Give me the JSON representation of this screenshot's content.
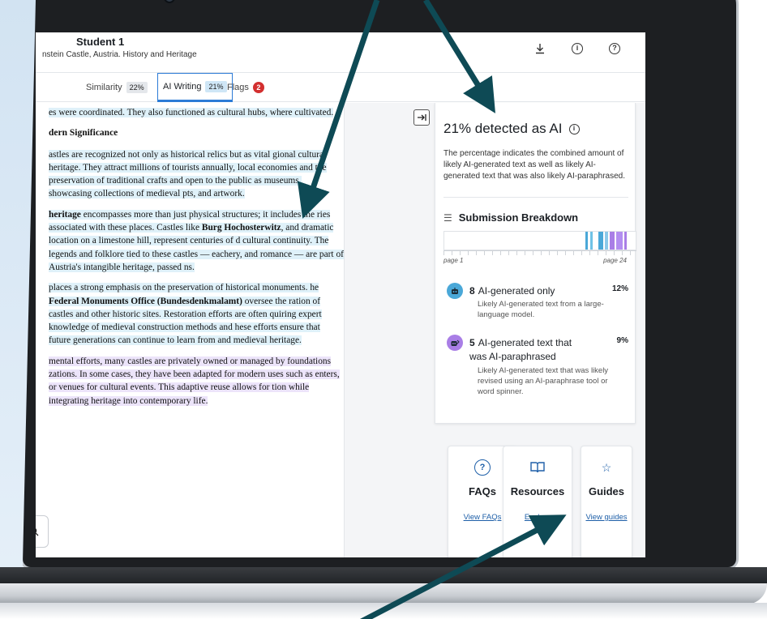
{
  "header": {
    "student_name": "Student 1",
    "doc_title": "nstein Castle, Austria. History and Heritage",
    "icons": [
      "download-icon",
      "info-icon",
      "help-icon"
    ]
  },
  "tabs": [
    {
      "label": "Similarity",
      "badge": "22%"
    },
    {
      "label": "AI Writing",
      "badge": "21%",
      "active": true
    },
    {
      "label": "Flags",
      "badge": "2"
    }
  ],
  "document": {
    "p1": "es were coordinated. They also functioned as cultural hubs, where cultivated.",
    "h1": "dern Significance",
    "p2": "astles are recognized not only as historical relics but as vital gional cultural heritage. They attract millions of tourists annually, local economies and the preservation of traditional crafts and open to the public as museums, showcasing collections of medieval pts, and artwork.",
    "p3a": "heritage",
    "p3b": " encompasses more than just physical structures; it includes the ries associated with these places. Castles like ",
    "p3c": "Burg Hochosterwitz",
    "p3d": ", and dramatic location on a limestone hill, represent centuries of d cultural continuity. The legends and folklore tied to these castles — eachery, and romance — are part of Austria's intangible heritage, passed ns.",
    "p4a": "places a strong emphasis on the preservation of historical monuments. he ",
    "p4b": "Federal Monuments Office (Bundesdenkmalamt)",
    "p4c": " oversee the ration of castles and other historic sites. Restoration efforts are often quiring expert knowledge of medieval construction methods and hese efforts ensure that future generations can continue to learn from and medieval heritage.",
    "p5": "mental efforts, many castles are privately owned or managed by foundations zations. In some cases, they have been adapted for modern uses such as enters, or venues for cultural events. This adaptive reuse allows for tion while integrating heritage into contemporary life."
  },
  "ai_panel": {
    "title": "21% detected as AI",
    "description": "The percentage indicates the combined amount of likely AI-generated text as well as likely AI-generated text that was also likely AI-paraphrased.",
    "breakdown_title": "Submission Breakdown",
    "page_first": "page 1",
    "page_last": "page 24",
    "categories": [
      {
        "count": "8",
        "label": "AI-generated only",
        "pct": "12%",
        "desc": "Likely AI-generated text from a large-language model.",
        "color": "#4aa8d8"
      },
      {
        "count": "5",
        "label": "AI-generated text that was AI-paraphrased",
        "pct": "9%",
        "desc": "Likely AI-generated text that was likely revised using an AI-paraphrase tool or word spinner.",
        "color": "#a97ee6"
      }
    ]
  },
  "resources": [
    {
      "title": "FAQs",
      "link": "View FAQs",
      "icon": "question-circle-icon"
    },
    {
      "title": "Resources",
      "link": "Explore",
      "icon": "book-icon"
    },
    {
      "title": "Guides",
      "link": "View guides",
      "icon": "star-icon"
    }
  ],
  "colors": {
    "accent": "#2c7bd6",
    "ai_blue": "#4aa8d8",
    "ai_purple": "#a97ee6",
    "flag_red": "#d32f2f",
    "arrow": "#0e4a55"
  }
}
